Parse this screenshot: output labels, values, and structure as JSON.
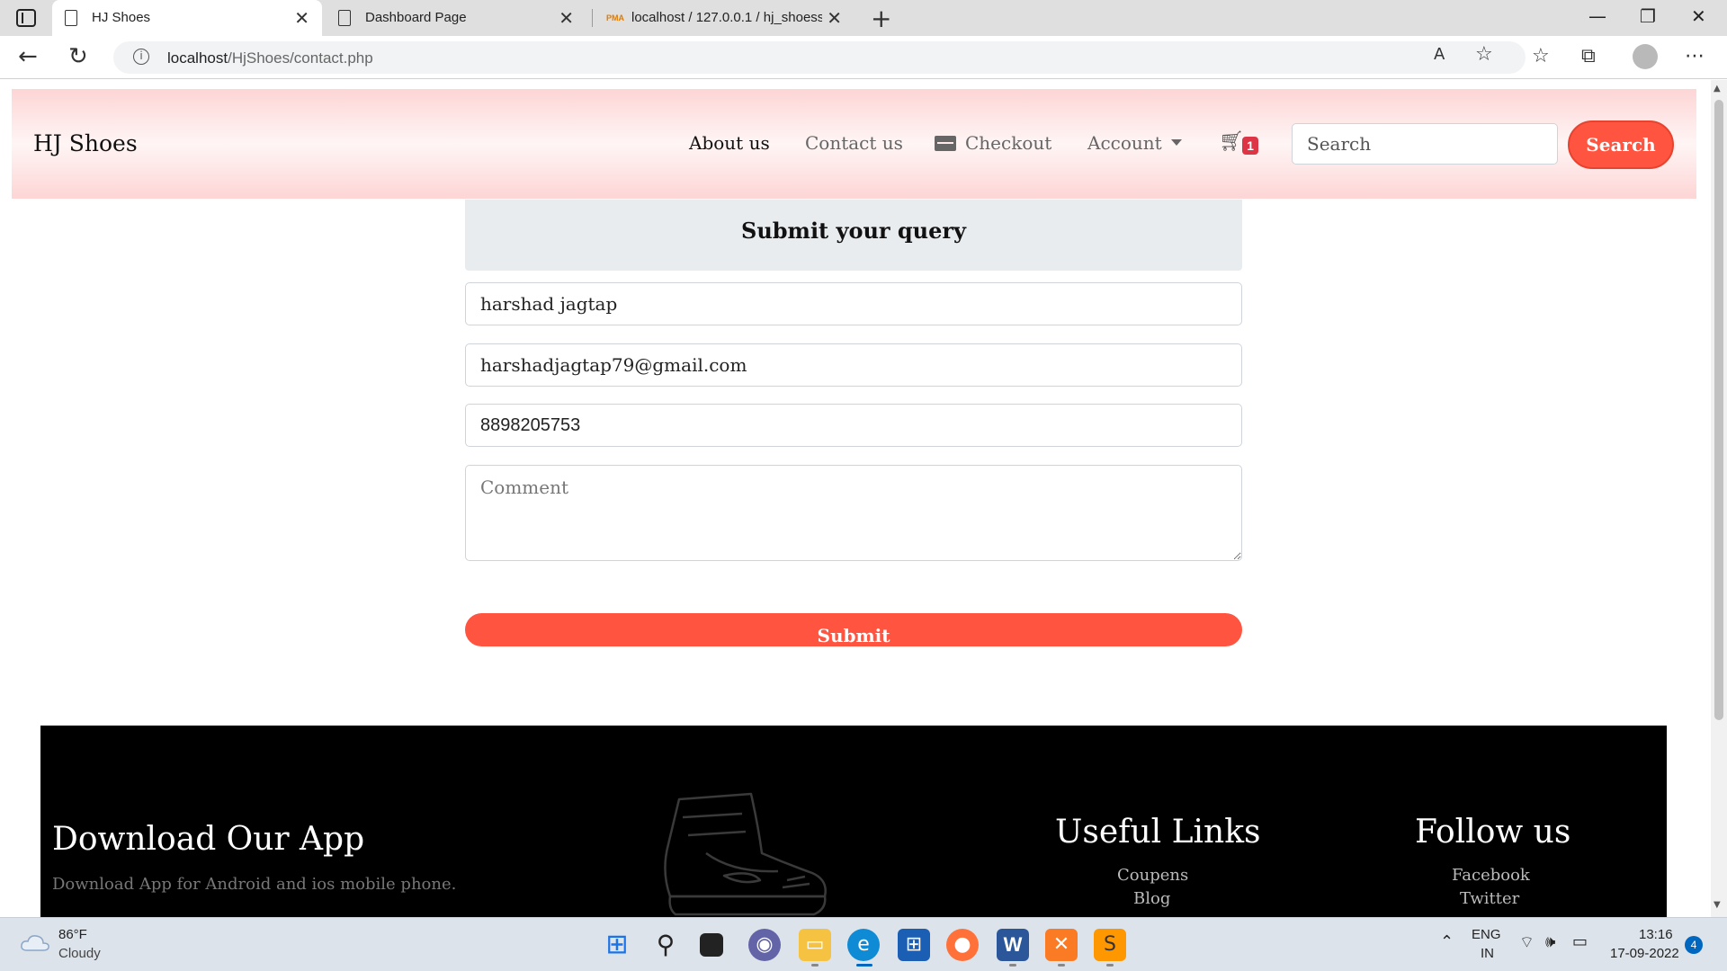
{
  "browser": {
    "tabs": [
      {
        "title": "HJ Shoes",
        "active": true
      },
      {
        "title": "Dashboard Page",
        "active": false
      },
      {
        "title": "localhost / 127.0.0.1 / hj_shoess",
        "active": false
      }
    ],
    "pma_label": "PMA",
    "url_host": "localhost",
    "url_path": "/HjShoes/contact.php"
  },
  "navbar": {
    "brand": "HJ Shoes",
    "links": [
      "About us",
      "Contact us",
      "Checkout",
      "Account"
    ],
    "cart_count": "1",
    "search_placeholder": "Search",
    "search_button": "Search"
  },
  "form": {
    "title": "Submit your query",
    "name_value": "harshad jagtap",
    "email_value": "harshadjagtap79@gmail.com",
    "phone_value": "8898205753",
    "comment_placeholder": "Comment",
    "submit_label": "Submit"
  },
  "footer": {
    "app_title": "Download Our App",
    "app_subtitle": "Download App for Android and ios mobile phone.",
    "useful_links_title": "Useful Links",
    "useful_links": [
      "Coupens",
      "Blog"
    ],
    "follow_title": "Follow us",
    "follow_links": [
      "Facebook",
      "Twitter"
    ]
  },
  "taskbar": {
    "temperature": "86°F",
    "condition": "Cloudy",
    "lang_line1": "ENG",
    "lang_line2": "IN",
    "time": "13:16",
    "date": "17-09-2022",
    "notification_count": "4"
  },
  "colors": {
    "accent": "#ff5440",
    "navbar_pink": "#fdd5d5",
    "badge_red": "#dc3545"
  }
}
